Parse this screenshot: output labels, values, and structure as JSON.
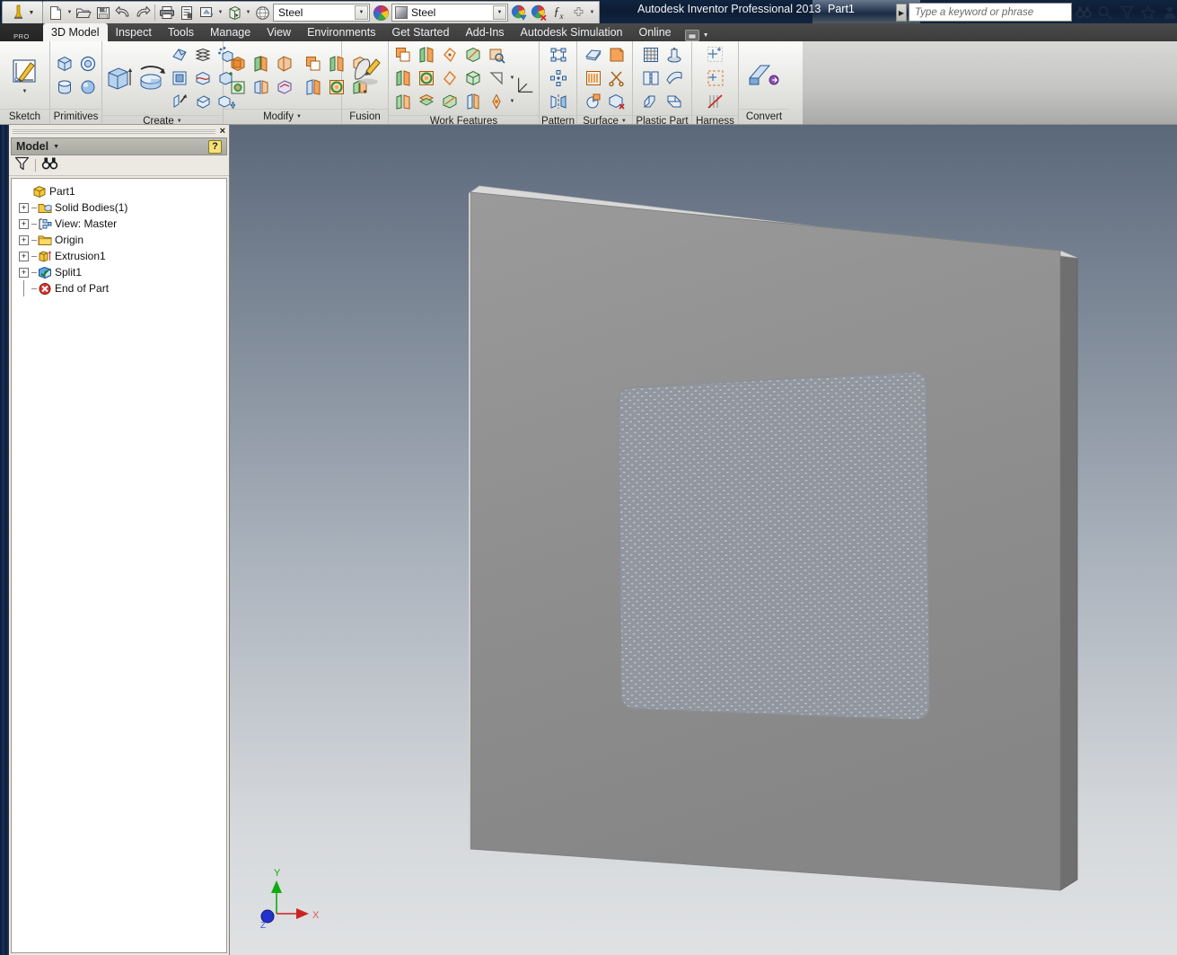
{
  "app": {
    "title": "Autodesk Inventor Professional 2013",
    "document_name": "Part1",
    "logo_badge": "PRO"
  },
  "quick_access": {
    "items": [
      {
        "name": "new-file-button",
        "icon": "new-file-icon"
      },
      {
        "name": "new-file-dropdown",
        "icon": "chevron-down-icon"
      },
      {
        "name": "open-file-button",
        "icon": "open-folder-icon"
      },
      {
        "name": "save-button",
        "icon": "save-disk-icon"
      },
      {
        "name": "undo-button",
        "icon": "undo-arrow-icon"
      },
      {
        "name": "redo-button",
        "icon": "redo-arrow-icon"
      },
      {
        "name": "print-button",
        "icon": "printer-icon"
      },
      {
        "name": "parameters-button",
        "icon": "parameters-icon"
      },
      {
        "name": "update-button",
        "icon": "update-icon"
      },
      {
        "name": "update-dropdown",
        "icon": "chevron-down-icon"
      },
      {
        "name": "return-button",
        "icon": "return-icon"
      },
      {
        "name": "return-dropdown",
        "icon": "chevron-down-icon"
      },
      {
        "name": "appearance-browser-button",
        "icon": "sphere-mesh-icon"
      }
    ],
    "material_combo": {
      "value": "Steel",
      "arrow": "chevron-down-icon"
    },
    "appearance_combo": {
      "value": "Steel",
      "arrow": "chevron-down-icon"
    },
    "adjust_button": "adjust-appearance-icon",
    "clear_button": "clear-appearance-icon",
    "fx_button": "fx-icon",
    "add_button": "plus-icon",
    "overflow_button": "chevron-down-icon"
  },
  "search": {
    "placeholder": "Type a keyword or phrase",
    "expander": "play-arrow-icon",
    "icons": [
      {
        "name": "search-icon",
        "label": "binoculars-icon"
      },
      {
        "name": "help-magnifier-icon",
        "label": "magnifier-icon"
      },
      {
        "name": "info-center-icon",
        "label": "funnel-icon"
      },
      {
        "name": "favorites-icon",
        "label": "star-icon"
      },
      {
        "name": "account-icon",
        "label": "person-icon"
      }
    ]
  },
  "ribbon": {
    "tabs": [
      {
        "label": "3D Model",
        "active": true
      },
      {
        "label": "Inspect",
        "active": false
      },
      {
        "label": "Tools",
        "active": false
      },
      {
        "label": "Manage",
        "active": false
      },
      {
        "label": "View",
        "active": false
      },
      {
        "label": "Environments",
        "active": false
      },
      {
        "label": "Get Started",
        "active": false
      },
      {
        "label": "Add-Ins",
        "active": false
      },
      {
        "label": "Autodesk Simulation",
        "active": false
      },
      {
        "label": "Online",
        "active": false
      }
    ],
    "minimize_icon": "ribbon-minimize-icon",
    "minimize_caret": "chevron-down-icon",
    "panels": [
      {
        "label": "Sketch",
        "has_caret": false
      },
      {
        "label": "Primitives",
        "has_caret": false
      },
      {
        "label": "Create",
        "has_caret": true
      },
      {
        "label": "Modify",
        "has_caret": true
      },
      {
        "label": "Fusion",
        "has_caret": false
      },
      {
        "label": "Work Features",
        "has_caret": false
      },
      {
        "label": "Pattern",
        "has_caret": false
      },
      {
        "label": "Surface",
        "has_caret": true
      },
      {
        "label": "Plastic Part",
        "has_caret": false
      },
      {
        "label": "Harness",
        "has_caret": false
      },
      {
        "label": "Convert",
        "has_caret": false
      }
    ]
  },
  "browser": {
    "panel_title": "Model",
    "title_caret": "chevron-down-icon",
    "close_label": "×",
    "help_label": "?",
    "tools": [
      {
        "name": "filter-button",
        "icon": "funnel-icon"
      },
      {
        "name": "find-button",
        "icon": "binoculars-icon"
      }
    ],
    "tree": [
      {
        "label": "Part1",
        "indent": 0,
        "expander": "",
        "icon": "part-cube-icon"
      },
      {
        "label": "Solid Bodies(1)",
        "indent": 1,
        "expander": "+",
        "icon": "solid-bodies-folder-icon"
      },
      {
        "label": "View: Master",
        "indent": 1,
        "expander": "+",
        "icon": "view-master-icon"
      },
      {
        "label": "Origin",
        "indent": 1,
        "expander": "+",
        "icon": "origin-folder-icon"
      },
      {
        "label": "Extrusion1",
        "indent": 1,
        "expander": "+",
        "icon": "extrusion-icon"
      },
      {
        "label": "Split1",
        "indent": 1,
        "expander": "+",
        "icon": "split-icon"
      },
      {
        "label": "End of Part",
        "indent": 1,
        "expander": "",
        "icon": "end-of-part-icon"
      }
    ]
  },
  "viewport": {
    "axis_indicator": {
      "x_label": "X",
      "y_label": "Y",
      "z_label": "Z",
      "x_color": "#cc2222",
      "y_color": "#11aa11",
      "z_color": "#2233cc"
    },
    "model": {
      "face_color": "#8e8e8e",
      "top_edge_color": "#d7d7d7",
      "right_edge_color": "#767676",
      "mesh_color": "#a5adb6",
      "description": "Flat rectangular plate with rounded-square honeycomb mesh region"
    },
    "background": {
      "top_color": "#5b6879",
      "bottom_color": "#dfe1e3"
    }
  }
}
